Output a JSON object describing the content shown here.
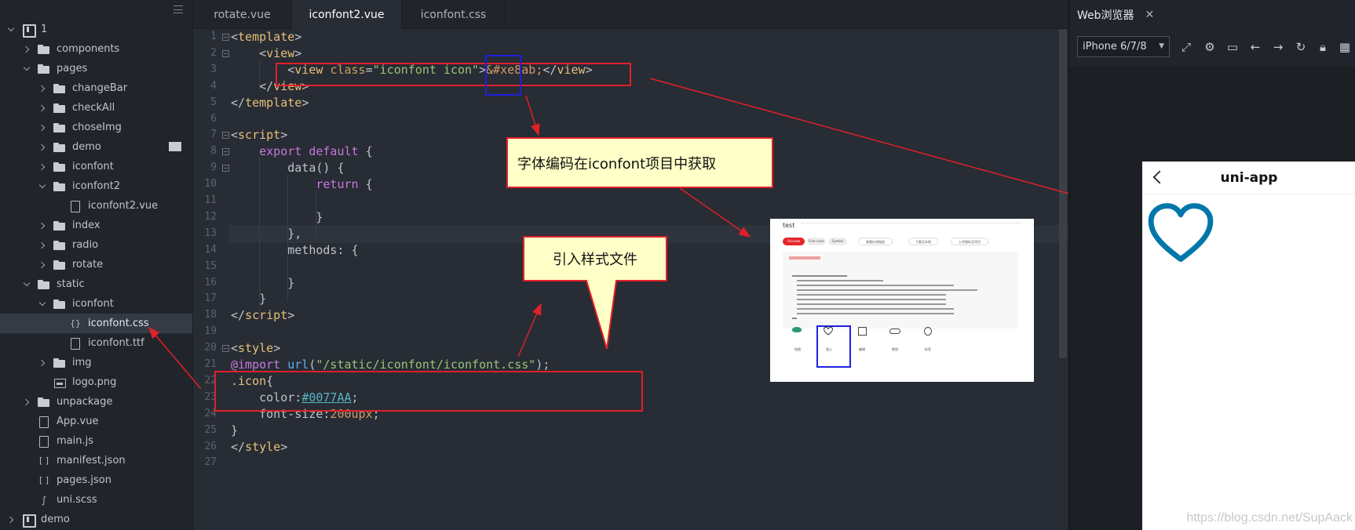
{
  "sidebar": {
    "tree": [
      {
        "label": "1",
        "kind": "project",
        "chev": "down",
        "depth": 0
      },
      {
        "label": "components",
        "kind": "folder",
        "chev": "right",
        "depth": 1
      },
      {
        "label": "pages",
        "kind": "folder",
        "chev": "down",
        "depth": 1
      },
      {
        "label": "changeBar",
        "kind": "folder",
        "chev": "right",
        "depth": 2
      },
      {
        "label": "checkAll",
        "kind": "folder",
        "chev": "right",
        "depth": 2
      },
      {
        "label": "choseImg",
        "kind": "folder",
        "chev": "right",
        "depth": 2
      },
      {
        "label": "demo",
        "kind": "folder",
        "chev": "right",
        "depth": 2
      },
      {
        "label": "iconfont",
        "kind": "folder",
        "chev": "right",
        "depth": 2
      },
      {
        "label": "iconfont2",
        "kind": "folder",
        "chev": "down",
        "depth": 2
      },
      {
        "label": "iconfont2.vue",
        "kind": "vue",
        "chev": "",
        "depth": 3
      },
      {
        "label": "index",
        "kind": "folder",
        "chev": "right",
        "depth": 2
      },
      {
        "label": "radio",
        "kind": "folder",
        "chev": "right",
        "depth": 2
      },
      {
        "label": "rotate",
        "kind": "folder",
        "chev": "right",
        "depth": 2
      },
      {
        "label": "static",
        "kind": "folder",
        "chev": "down",
        "depth": 1
      },
      {
        "label": "iconfont",
        "kind": "folder",
        "chev": "down",
        "depth": 2
      },
      {
        "label": "iconfont.css",
        "kind": "css",
        "chev": "",
        "depth": 3
      },
      {
        "label": "iconfont.ttf",
        "kind": "file",
        "chev": "",
        "depth": 3
      },
      {
        "label": "img",
        "kind": "folder",
        "chev": "right",
        "depth": 2
      },
      {
        "label": "logo.png",
        "kind": "image",
        "chev": "",
        "depth": 2
      },
      {
        "label": "unpackage",
        "kind": "folder",
        "chev": "right",
        "depth": 1
      },
      {
        "label": "App.vue",
        "kind": "vue",
        "chev": "",
        "depth": 1
      },
      {
        "label": "main.js",
        "kind": "file",
        "chev": "",
        "depth": 1
      },
      {
        "label": "manifest.json",
        "kind": "json",
        "chev": "",
        "depth": 1
      },
      {
        "label": "pages.json",
        "kind": "json",
        "chev": "",
        "depth": 1
      },
      {
        "label": "uni.scss",
        "kind": "sass",
        "chev": "",
        "depth": 1
      },
      {
        "label": "demo",
        "kind": "project",
        "chev": "right",
        "depth": 0
      }
    ]
  },
  "tabs": [
    {
      "label": "rotate.vue",
      "active": false
    },
    {
      "label": "iconfont2.vue",
      "active": true
    },
    {
      "label": "iconfont.css",
      "active": false
    }
  ],
  "editor": {
    "lines": [
      [
        [
          "t-punc",
          "<"
        ],
        [
          "t-tag",
          "template"
        ],
        [
          "t-punc",
          ">"
        ]
      ],
      [
        [
          "t-plain",
          "    "
        ],
        [
          "t-punc",
          "<"
        ],
        [
          "t-tag",
          "view"
        ],
        [
          "t-punc",
          ">"
        ]
      ],
      [
        [
          "t-plain",
          "        "
        ],
        [
          "t-punc",
          "<"
        ],
        [
          "t-tag",
          "view"
        ],
        [
          "t-plain",
          " "
        ],
        [
          "t-attr",
          "class"
        ],
        [
          "t-punc",
          "="
        ],
        [
          "t-str",
          "\"iconfont icon\""
        ],
        [
          "t-punc",
          ">"
        ],
        [
          "t-num",
          "&#xe8ab;"
        ],
        [
          "t-punc",
          "</"
        ],
        [
          "t-tag",
          "view"
        ],
        [
          "t-punc",
          ">"
        ]
      ],
      [
        [
          "t-plain",
          "    "
        ],
        [
          "t-punc",
          "</"
        ],
        [
          "t-tag",
          "view"
        ],
        [
          "t-punc",
          ">"
        ]
      ],
      [
        [
          "t-punc",
          "</"
        ],
        [
          "t-tag",
          "template"
        ],
        [
          "t-punc",
          ">"
        ]
      ],
      [],
      [
        [
          "t-punc",
          "<"
        ],
        [
          "t-tag",
          "script"
        ],
        [
          "t-punc",
          ">"
        ]
      ],
      [
        [
          "t-plain",
          "    "
        ],
        [
          "t-kw",
          "export"
        ],
        [
          "t-plain",
          " "
        ],
        [
          "t-kw",
          "default"
        ],
        [
          "t-plain",
          " {"
        ]
      ],
      [
        [
          "t-plain",
          "        "
        ],
        [
          "t-prop",
          "data"
        ],
        [
          "t-plain",
          "() {"
        ]
      ],
      [
        [
          "t-plain",
          "            "
        ],
        [
          "t-kw",
          "return"
        ],
        [
          "t-plain",
          " {"
        ]
      ],
      [],
      [
        [
          "t-plain",
          "            }"
        ]
      ],
      [
        [
          "t-plain",
          "        },"
        ]
      ],
      [
        [
          "t-plain",
          "        "
        ],
        [
          "t-prop",
          "methods"
        ],
        [
          "t-plain",
          ": {"
        ]
      ],
      [],
      [
        [
          "t-plain",
          "        }"
        ]
      ],
      [
        [
          "t-plain",
          "    }"
        ]
      ],
      [
        [
          "t-punc",
          "</"
        ],
        [
          "t-tag",
          "script"
        ],
        [
          "t-punc",
          ">"
        ]
      ],
      [],
      [
        [
          "t-punc",
          "<"
        ],
        [
          "t-tag",
          "style"
        ],
        [
          "t-punc",
          ">"
        ]
      ],
      [
        [
          "t-at",
          "@import"
        ],
        [
          "t-plain",
          " "
        ],
        [
          "t-fn",
          "url"
        ],
        [
          "t-plain",
          "("
        ],
        [
          "t-str",
          "\"/static/iconfont/iconfont.css\""
        ],
        [
          "t-plain",
          ");"
        ]
      ],
      [
        [
          "t-tag",
          ".icon"
        ],
        [
          "t-plain",
          "{"
        ]
      ],
      [
        [
          "t-plain",
          "    "
        ],
        [
          "t-prop",
          "color"
        ],
        [
          "t-plain",
          ":"
        ],
        [
          "t-hex",
          "#0077AA"
        ],
        [
          "t-plain",
          ";"
        ]
      ],
      [
        [
          "t-plain",
          "    "
        ],
        [
          "t-prop",
          "font-size"
        ],
        [
          "t-plain",
          ":"
        ],
        [
          "t-num",
          "200upx"
        ],
        [
          "t-plain",
          ";"
        ]
      ],
      [
        [
          "t-plain",
          "}"
        ]
      ],
      [
        [
          "t-punc",
          "</"
        ],
        [
          "t-tag",
          "style"
        ],
        [
          "t-punc",
          ">"
        ]
      ],
      []
    ],
    "line_numbers": [
      "1",
      "2",
      "3",
      "4",
      "5",
      "6",
      "7",
      "8",
      "9",
      "10",
      "11",
      "12",
      "13",
      "14",
      "15",
      "16",
      "17",
      "18",
      "19",
      "20",
      "21",
      "22",
      "23",
      "24",
      "25",
      "26",
      "27"
    ]
  },
  "annotations": {
    "note1": "字体编码在iconfont项目中获取",
    "note2": "引入样式文件"
  },
  "iconfont_shot": {
    "project": "test",
    "tabs": [
      "Unicode",
      "Font class",
      "Symbol"
    ],
    "buttons": [
      "查看在线链接",
      "下载至本地",
      "上传图标至项目"
    ],
    "icon_labels": [
      "地图",
      "爱心",
      "编辑",
      "眼镜",
      "标签"
    ]
  },
  "preview": {
    "title": "Web浏览器",
    "device": "iPhone 6/7/8",
    "nav_title": "uni-app",
    "icon_color": "#0077AA",
    "watermark": "https://blog.csdn.net/SupAack"
  },
  "colors": {
    "annotation_red": "#e0202a",
    "annotation_blue": "#2020e0",
    "note_bg": "#ffffc8"
  }
}
